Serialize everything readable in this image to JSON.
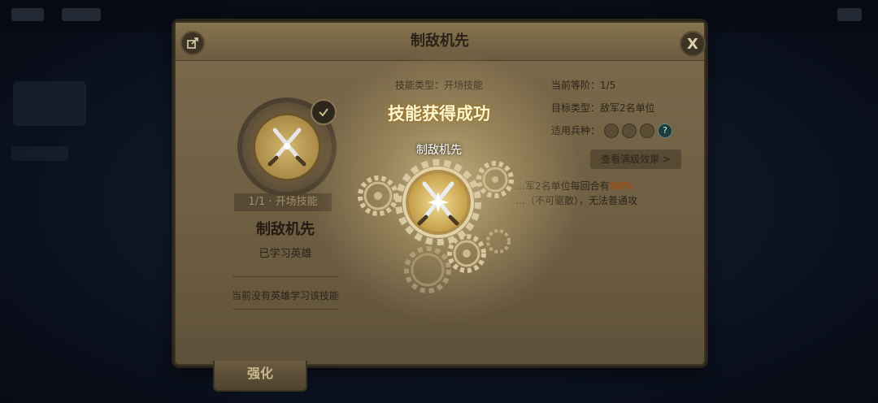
{
  "modal": {
    "title": "制敌机先",
    "close_label": "X"
  },
  "left_panel": {
    "level_tag": "1/1 · 开场技能",
    "skill_name": "制敌机先",
    "learned_status": "已学习英雄",
    "no_hero_note": "当前没有英雄学习该技能"
  },
  "info": {
    "skill_type_label": "技能类型：",
    "skill_type_value": "开场技能",
    "current_level_label": "当前等阶：",
    "current_level_value": "1/5",
    "target_type_label": "目标类型：",
    "target_type_value": "敌军2名单位",
    "applicable_label": "适用兵种：",
    "detail_button": "查看满级效果 >"
  },
  "description": {
    "line1_prefix": "…军2名单位每回合有",
    "line1_highlight": "30%",
    "line2": "…（不可驱散），无法普通攻"
  },
  "overlay": {
    "success_title": "技能获得成功",
    "skill_name": "制敌机先"
  },
  "tabs": {
    "strengthen": "强化"
  },
  "colors": {
    "panel": "#7c6a4b",
    "highlight": "#a04a10",
    "background": "#0b1220"
  }
}
